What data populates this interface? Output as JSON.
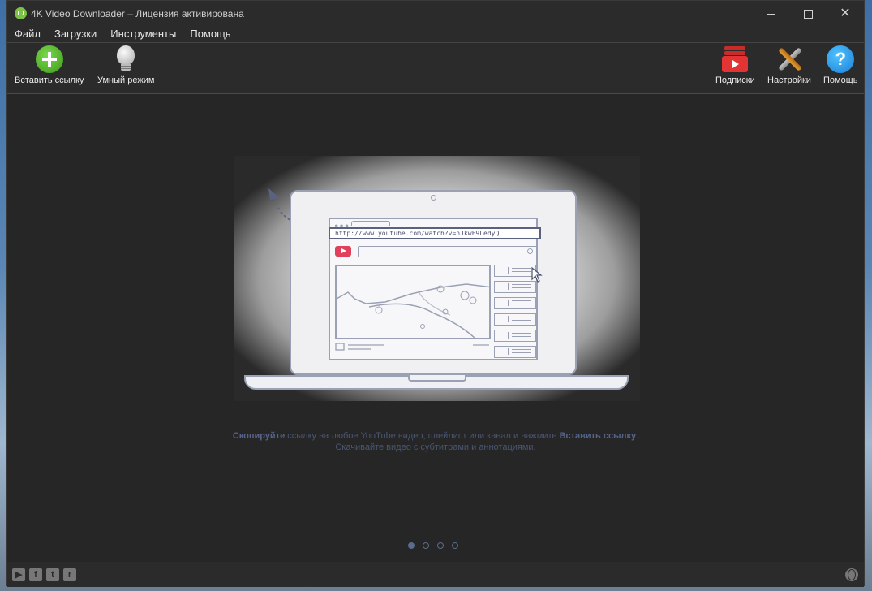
{
  "window": {
    "title": "4K Video Downloader – Лицензия активирована",
    "controls": {
      "minimize": "minimize-icon",
      "maximize": "maximize-icon",
      "close": "✕"
    }
  },
  "menu": [
    "Файл",
    "Загрузки",
    "Инструменты",
    "Помощь"
  ],
  "toolbar": {
    "paste_link": "Вставить ссылку",
    "smart_mode": "Умный режим",
    "subscriptions": "Подписки",
    "settings": "Настройки",
    "help": "Помощь",
    "help_glyph": "?"
  },
  "illustration": {
    "url": "http://www.youtube.com/watch?v=nJkwF9LedyQ"
  },
  "hint": {
    "line1_bold_start": "Скопируйте",
    "line1_middle": " ссылку на любое YouTube видео, плейлист или канал и нажмите ",
    "line1_bold_end": "Вставить ссылку",
    "line1_tail": ".",
    "line2": "Скачивайте видео с субтитрами и аннотациями."
  },
  "pager": {
    "pages": 4,
    "active": 1
  },
  "statusbar": {
    "social": [
      "youtube-icon",
      "facebook-icon",
      "twitter-icon",
      "reddit-icon"
    ],
    "social_glyphs": [
      "▶",
      "f",
      "t",
      "r"
    ],
    "right_icon": "globe-icon"
  }
}
